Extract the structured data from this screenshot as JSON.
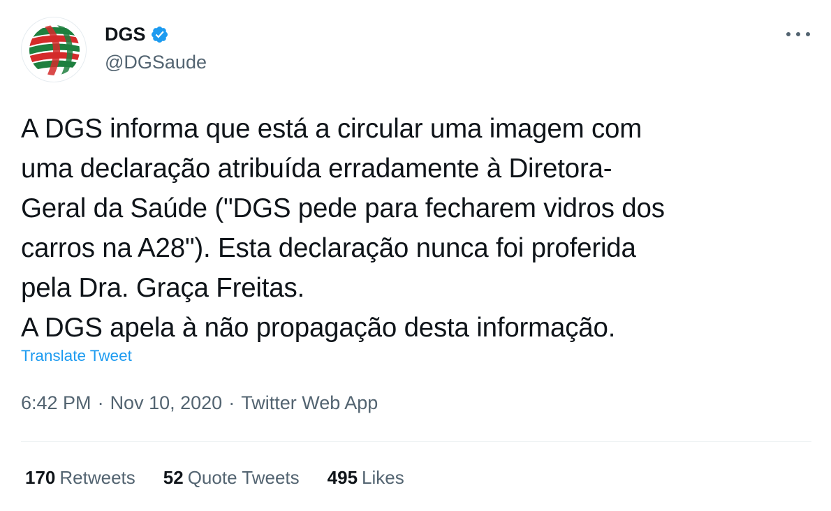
{
  "tweet": {
    "author": {
      "name": "DGS",
      "handle": "@DGSaude",
      "verified": true,
      "avatar_icon": "dgs-logo"
    },
    "text": "A DGS informa que está a circular uma imagem com\numa declaração atribuída erradamente à Diretora-\nGeral da Saúde (\"DGS pede para fecharem vidros dos\ncarros na A28\"). Esta declaração nunca foi proferida\npela Dra. Graça Freitas.\nA DGS apela à não propagação desta informação.",
    "translate_label": "Translate Tweet",
    "time": "6:42 PM",
    "separator": "·",
    "date": "Nov 10, 2020",
    "source": "Twitter Web App",
    "stats": {
      "retweets": {
        "count": "170",
        "label": "Retweets"
      },
      "quotes": {
        "count": "52",
        "label": "Quote Tweets"
      },
      "likes": {
        "count": "495",
        "label": "Likes"
      }
    }
  },
  "colors": {
    "text": "#0f1419",
    "secondary": "#536471",
    "link": "#1d9bf0",
    "verified": "#1d9bf0",
    "logo_green": "#1e7f3e",
    "logo_red": "#d42a2a"
  }
}
